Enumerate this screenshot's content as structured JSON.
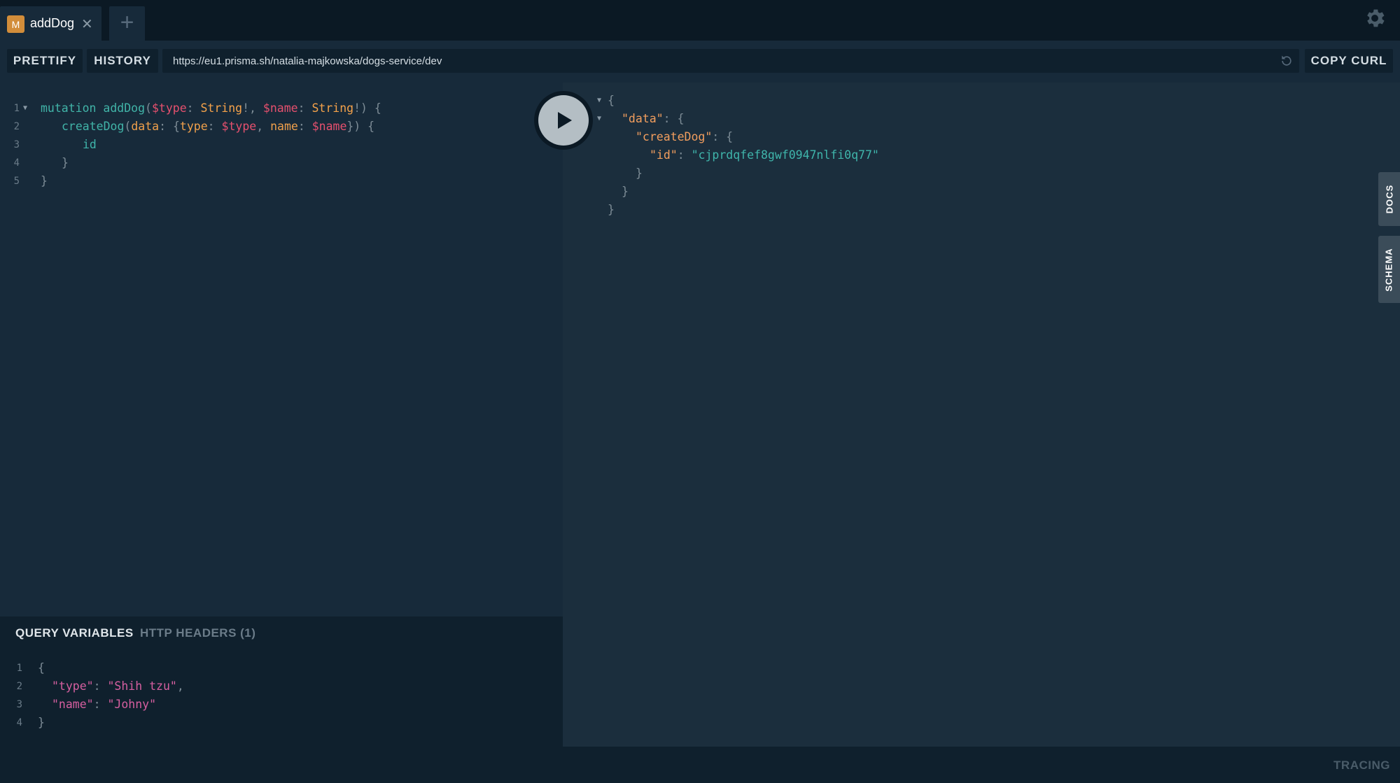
{
  "tabs": [
    {
      "badge": "M",
      "title": "addDog",
      "close": "✕"
    }
  ],
  "new_tab_label": "+",
  "toolbar": {
    "prettify_label": "PRETTIFY",
    "history_label": "HISTORY",
    "url": "https://eu1.prisma.sh/natalia-majkowska/dogs-service/dev",
    "copy_curl_label": "COPY CURL"
  },
  "query": {
    "line_numbers": [
      "1",
      "2",
      "3",
      "4",
      "5"
    ],
    "lines": [
      {
        "indent": 0,
        "tokens": [
          [
            "kw",
            "mutation "
          ],
          [
            "fn",
            "addDog"
          ],
          [
            "punc",
            "("
          ],
          [
            "var",
            "$type"
          ],
          [
            "punc",
            ": "
          ],
          [
            "type",
            "String"
          ],
          [
            "punc",
            "!, "
          ],
          [
            "var",
            "$name"
          ],
          [
            "punc",
            ": "
          ],
          [
            "type",
            "String"
          ],
          [
            "punc",
            "!) {"
          ]
        ]
      },
      {
        "indent": 1,
        "tokens": [
          [
            "fn",
            "createDog"
          ],
          [
            "punc",
            "("
          ],
          [
            "arg",
            "data"
          ],
          [
            "punc",
            ": {"
          ],
          [
            "arg",
            "type"
          ],
          [
            "punc",
            ": "
          ],
          [
            "var",
            "$type"
          ],
          [
            "punc",
            ", "
          ],
          [
            "arg",
            "name"
          ],
          [
            "punc",
            ": "
          ],
          [
            "var",
            "$name"
          ],
          [
            "punc",
            "}) {"
          ]
        ]
      },
      {
        "indent": 2,
        "tokens": [
          [
            "field",
            "id"
          ]
        ]
      },
      {
        "indent": 1,
        "tokens": [
          [
            "punc",
            "}"
          ]
        ]
      },
      {
        "indent": 0,
        "tokens": [
          [
            "punc",
            "}"
          ]
        ]
      }
    ]
  },
  "result": {
    "lines": [
      {
        "indent": 0,
        "tokens": [
          [
            "punc",
            "{"
          ]
        ]
      },
      {
        "indent": 1,
        "tokens": [
          [
            "key",
            "\"data\""
          ],
          [
            "punc",
            ": {"
          ]
        ]
      },
      {
        "indent": 2,
        "tokens": [
          [
            "key",
            "\"createDog\""
          ],
          [
            "punc",
            ": {"
          ]
        ]
      },
      {
        "indent": 3,
        "tokens": [
          [
            "key",
            "\"id\""
          ],
          [
            "punc",
            ": "
          ],
          [
            "str",
            "\"cjprdqfef8gwf0947nlfi0q77\""
          ]
        ]
      },
      {
        "indent": 2,
        "tokens": [
          [
            "punc",
            "}"
          ]
        ]
      },
      {
        "indent": 1,
        "tokens": [
          [
            "punc",
            "}"
          ]
        ]
      },
      {
        "indent": 0,
        "tokens": [
          [
            "punc",
            "}"
          ]
        ]
      }
    ]
  },
  "side_tabs": {
    "docs": "DOCS",
    "schema": "SCHEMA"
  },
  "variables_panel": {
    "tab_variables": "QUERY VARIABLES",
    "tab_headers": "HTTP HEADERS (1)",
    "line_numbers": [
      "1",
      "2",
      "3",
      "4"
    ],
    "lines": [
      {
        "indent": 0,
        "tokens": [
          [
            "punc",
            "{"
          ]
        ]
      },
      {
        "indent": 1,
        "tokens": [
          [
            "keypink",
            "\"type\""
          ],
          [
            "punc",
            ": "
          ],
          [
            "strpink",
            "\"Shih tzu\""
          ],
          [
            "punc",
            ","
          ]
        ]
      },
      {
        "indent": 1,
        "tokens": [
          [
            "keypink",
            "\"name\""
          ],
          [
            "punc",
            ": "
          ],
          [
            "strpink",
            "\"Johny\""
          ]
        ]
      },
      {
        "indent": 0,
        "tokens": [
          [
            "punc",
            "}"
          ]
        ]
      }
    ]
  },
  "footer": {
    "tracing_label": "TRACING"
  },
  "colors": {
    "background": "#172a3a",
    "tabbar": "#0b1924",
    "badge": "#d28d3a",
    "result_bg": "#1b2e3d"
  }
}
